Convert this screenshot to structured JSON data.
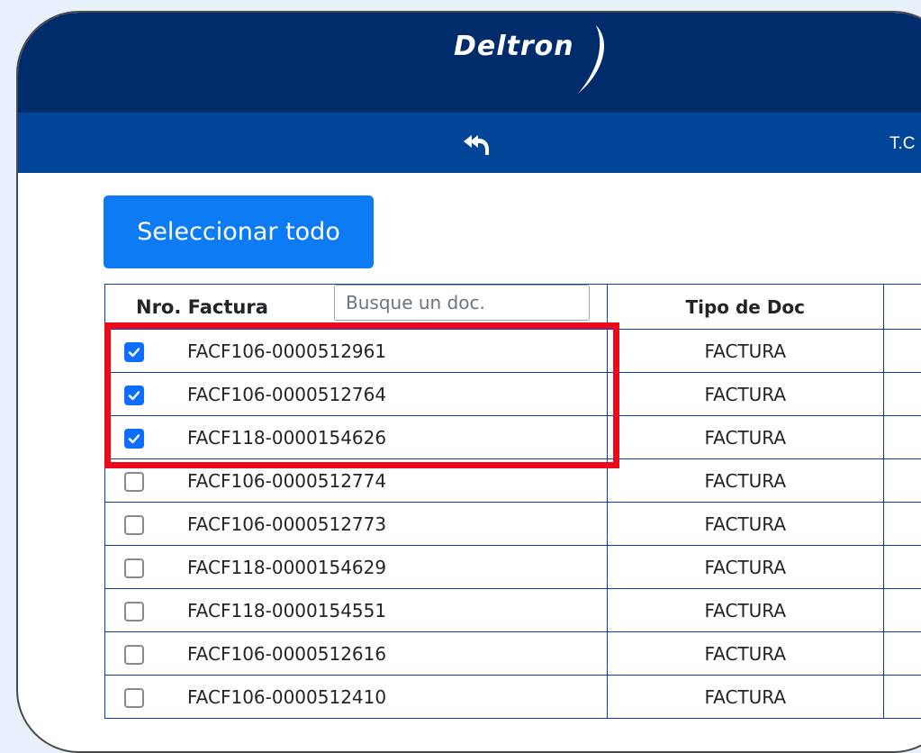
{
  "brand": {
    "logo_text": "Deltron"
  },
  "nav": {
    "back_icon": "reply-arrow-icon",
    "tc_label": "T.C"
  },
  "actions": {
    "select_all_label": "Seleccionar todo"
  },
  "table": {
    "headers": {
      "nro": "Nro. Factura",
      "tipo": "Tipo de Doc"
    },
    "search_placeholder": "Busque un doc.",
    "rows": [
      {
        "nro": "FACF106-0000512961",
        "tipo": "FACTURA",
        "checked": true
      },
      {
        "nro": "FACF106-0000512764",
        "tipo": "FACTURA",
        "checked": true
      },
      {
        "nro": "FACF118-0000154626",
        "tipo": "FACTURA",
        "checked": true
      },
      {
        "nro": "FACF106-0000512774",
        "tipo": "FACTURA",
        "checked": false
      },
      {
        "nro": "FACF106-0000512773",
        "tipo": "FACTURA",
        "checked": false
      },
      {
        "nro": "FACF118-0000154629",
        "tipo": "FACTURA",
        "checked": false
      },
      {
        "nro": "FACF118-0000154551",
        "tipo": "FACTURA",
        "checked": false
      },
      {
        "nro": "FACF106-0000512616",
        "tipo": "FACTURA",
        "checked": false
      },
      {
        "nro": "FACF106-0000512410",
        "tipo": "FACTURA",
        "checked": false
      }
    ]
  },
  "colors": {
    "header_dark": "#012c6c",
    "nav_blue": "#014599",
    "button_blue": "#0d7cf4",
    "table_border": "#0f3ea4",
    "checkbox_checked": "#0d6efd",
    "highlight_red": "#ea0a1c"
  }
}
